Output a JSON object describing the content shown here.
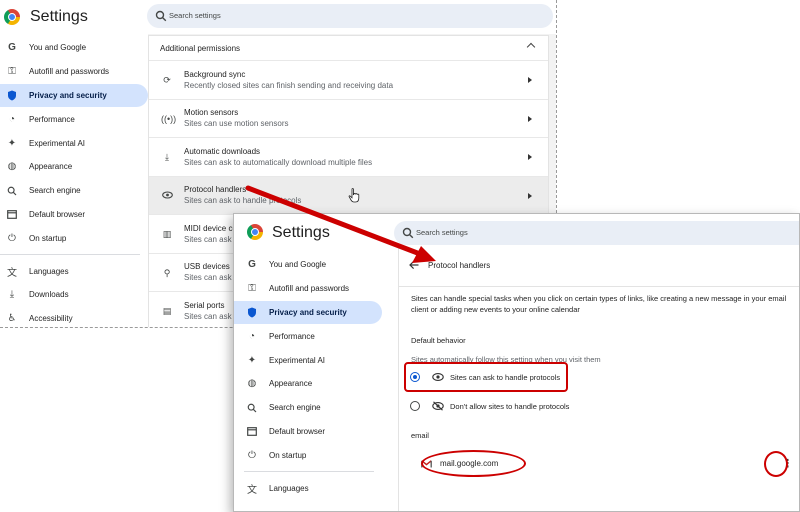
{
  "back_window": {
    "title": "Settings",
    "search_placeholder": "Search settings",
    "sidebar": [
      {
        "label": "You and Google",
        "icon": "google-g-icon"
      },
      {
        "label": "Autofill and passwords",
        "icon": "key-icon"
      },
      {
        "label": "Privacy and security",
        "icon": "shield-icon",
        "active": true
      },
      {
        "label": "Performance",
        "icon": "speedometer-icon"
      },
      {
        "label": "Experimental AI",
        "icon": "sparkle-icon"
      },
      {
        "label": "Appearance",
        "icon": "palette-icon"
      },
      {
        "label": "Search engine",
        "icon": "search-icon"
      },
      {
        "label": "Default browser",
        "icon": "browser-icon"
      },
      {
        "label": "On startup",
        "icon": "power-icon"
      },
      {
        "label": "Languages",
        "icon": "translate-icon"
      },
      {
        "label": "Downloads",
        "icon": "download-icon"
      },
      {
        "label": "Accessibility",
        "icon": "accessibility-icon"
      }
    ],
    "section_title": "Additional permissions",
    "permissions": [
      {
        "title": "Background sync",
        "subtitle": "Recently closed sites can finish sending and receiving data",
        "icon": "sync-icon"
      },
      {
        "title": "Motion sensors",
        "subtitle": "Sites can use motion sensors",
        "icon": "motion-sensor-icon"
      },
      {
        "title": "Automatic downloads",
        "subtitle": "Sites can ask to automatically download multiple files",
        "icon": "download-icon"
      },
      {
        "title": "Protocol handlers",
        "subtitle": "Sites can ask to handle protocols",
        "icon": "protocol-icon",
        "hover": true
      },
      {
        "title": "MIDI device control",
        "subtitle": "Sites can ask to",
        "icon": "midi-icon"
      },
      {
        "title": "USB devices",
        "subtitle": "Sites can ask to",
        "icon": "usb-icon"
      },
      {
        "title": "Serial ports",
        "subtitle": "Sites can ask to",
        "icon": "serial-icon"
      }
    ]
  },
  "front_window": {
    "title": "Settings",
    "search_placeholder": "Search settings",
    "sidebar": [
      {
        "label": "You and Google",
        "icon": "google-g-icon"
      },
      {
        "label": "Autofill and passwords",
        "icon": "key-icon"
      },
      {
        "label": "Privacy and security",
        "icon": "shield-icon",
        "active": true
      },
      {
        "label": "Performance",
        "icon": "speedometer-icon"
      },
      {
        "label": "Experimental AI",
        "icon": "sparkle-icon"
      },
      {
        "label": "Appearance",
        "icon": "palette-icon"
      },
      {
        "label": "Search engine",
        "icon": "search-icon"
      },
      {
        "label": "Default browser",
        "icon": "browser-icon"
      },
      {
        "label": "On startup",
        "icon": "power-icon"
      },
      {
        "label": "Languages",
        "icon": "translate-icon"
      }
    ],
    "page_title": "Protocol handlers",
    "description": "Sites can handle special tasks when you click on certain types of links, like creating a new message in your email client or adding new events to your online calendar",
    "default_behavior_label": "Default behavior",
    "default_behavior_sub": "Sites automatically follow this setting when you visit them",
    "options": [
      {
        "label": "Sites can ask to handle protocols",
        "selected": true
      },
      {
        "label": "Don't allow sites to handle protocols",
        "selected": false
      }
    ],
    "group_label": "email",
    "site": "mail.google.com",
    "more_menu_glyph": "⋮"
  },
  "colors": {
    "accent": "#0b57d0",
    "active_nav_bg": "#d3e3fd",
    "annotation_red": "#cc0000",
    "search_bg": "#e9eef6"
  }
}
